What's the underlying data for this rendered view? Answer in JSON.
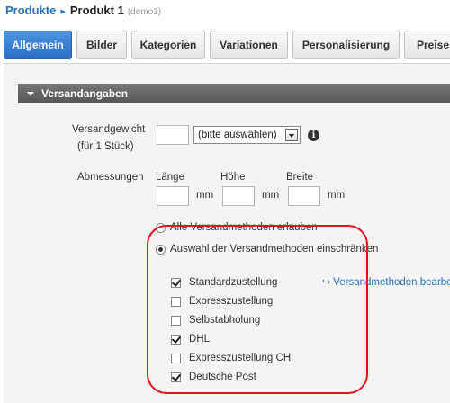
{
  "breadcrumb": {
    "root": "Produkte",
    "separator": "▸",
    "current": "Produkt 1",
    "id": "(demo1)"
  },
  "tabs": [
    {
      "label": "Allgemein",
      "active": true
    },
    {
      "label": "Bilder"
    },
    {
      "label": "Kategorien"
    },
    {
      "label": "Variationen"
    },
    {
      "label": "Personalisierung"
    },
    {
      "label": "Preise"
    }
  ],
  "section": {
    "title": "Versandangaben"
  },
  "weight": {
    "label": "Versandgewicht",
    "sublabel": "(für 1 Stück)",
    "value": "",
    "unit_selected": "(bitte auswählen)",
    "info_icon": "info-icon"
  },
  "dimensions": {
    "label": "Abmessungen",
    "length_label": "Länge",
    "height_label": "Höhe",
    "width_label": "Breite",
    "unit": "mm",
    "length": "",
    "height": "",
    "width": ""
  },
  "shipping": {
    "allow_all_label": "Alle Versandmethoden erlauben",
    "restrict_label": "Auswahl der Versandmethoden einschränken",
    "selected": "restrict",
    "edit_link": "Versandmethoden bearbeiten",
    "methods": [
      {
        "label": "Standardzustellung",
        "checked": true
      },
      {
        "label": "Expresszustellung",
        "checked": false
      },
      {
        "label": "Selbstabholung",
        "checked": false
      },
      {
        "label": "DHL",
        "checked": true
      },
      {
        "label": "Expresszustellung CH",
        "checked": false
      },
      {
        "label": "Deutsche Post",
        "checked": true
      }
    ]
  },
  "colors": {
    "accent": "#2a6fc7",
    "highlight": "#e0141c"
  }
}
